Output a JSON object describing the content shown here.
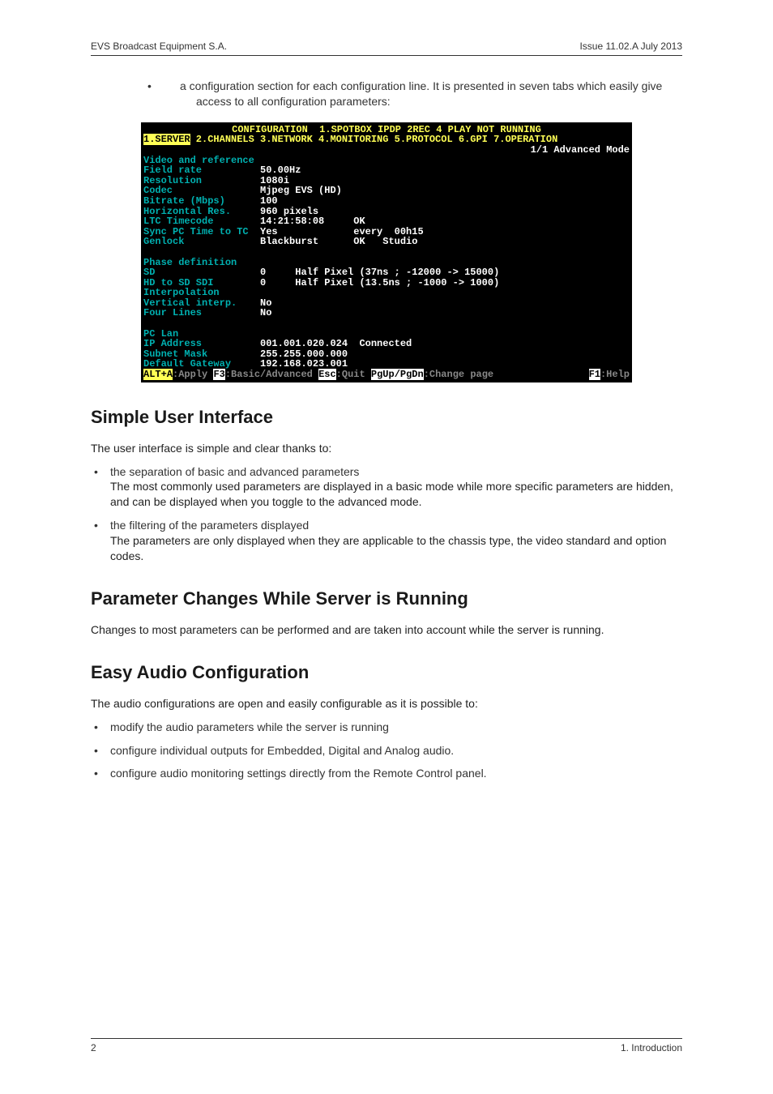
{
  "header": {
    "left": "EVS Broadcast Equipment S.A.",
    "right": "Issue 11.02.A  July 2013"
  },
  "intro": {
    "text": "a configuration section for each configuration line. It is presented in seven tabs which easily give access to all configuration parameters:"
  },
  "screenshot": {
    "title": "CONFIGURATION  1.SPOTBOX IPDP 2REC 4 PLAY NOT RUNNING",
    "tabs": {
      "selected": "1.SERVER",
      "rest": " 2.CHANNELS 3.NETWORK 4.MONITORING 5.PROTOCOL 6.GPI 7.OPERATION"
    },
    "mode": "1/1 Advanced Mode",
    "sections": [
      {
        "heading": "Video and reference",
        "rows": [
          {
            "label": "Field rate",
            "value": "50.00Hz"
          },
          {
            "label": "Resolution",
            "value": "1080i"
          },
          {
            "label": "Codec",
            "value": "Mjpeg EVS (HD)"
          },
          {
            "label": "Bitrate (Mbps)",
            "value": "100"
          },
          {
            "label": "Horizontal Res.",
            "value": "960 pixels"
          },
          {
            "label": "LTC Timecode",
            "value": "14:21:58:08     OK"
          },
          {
            "label": "Sync PC Time to TC",
            "value": "Yes             every  00h15"
          },
          {
            "label": "Genlock",
            "value": "Blackburst      OK   Studio"
          }
        ]
      },
      {
        "heading": "Phase definition",
        "rows": [
          {
            "label": "SD",
            "value": "0     Half Pixel (37ns ; -12000 -> 15000)"
          },
          {
            "label": "HD to SD SDI",
            "value": "0     Half Pixel (13.5ns ; -1000 -> 1000)"
          },
          {
            "label": "Interpolation",
            "value": ""
          },
          {
            "label": "Vertical interp.",
            "value": "No"
          },
          {
            "label": "Four Lines",
            "value": "No"
          }
        ]
      },
      {
        "heading": "PC Lan",
        "rows": [
          {
            "label": "IP Address",
            "value": "001.001.020.024  Connected"
          },
          {
            "label": "Subnet Mask",
            "value": "255.255.000.000"
          },
          {
            "label": "Default Gateway",
            "value": "192.168.023.001"
          }
        ]
      }
    ],
    "footer": {
      "k1": "ALT+A",
      "t1": ":Apply ",
      "k2": "F3",
      "t2": ":Basic/Advanced ",
      "k3": "Esc",
      "t3": ":Quit ",
      "k4": "PgUp/PgDn",
      "t4": ":Change page",
      "k5": "F1",
      "t5": ":Help"
    }
  },
  "sections": {
    "s1": {
      "title": "Simple User Interface",
      "intro": "The user interface is simple and clear thanks to:",
      "items": [
        {
          "text": "the separation of basic and advanced parameters",
          "sub": "The most commonly used parameters are displayed in a basic mode while more specific parameters are hidden, and can be displayed when you toggle to the advanced mode."
        },
        {
          "text": "the filtering of the parameters displayed",
          "sub": "The parameters are only displayed when they are applicable to the chassis type, the video standard and option codes."
        }
      ]
    },
    "s2": {
      "title": "Parameter Changes While Server is Running",
      "body": "Changes to most parameters can be performed and are taken into account while the server is running."
    },
    "s3": {
      "title": "Easy Audio Configuration",
      "intro": "The audio configurations are open and easily configurable as it is possible to:",
      "items": [
        {
          "text": "modify the audio parameters while the server is running"
        },
        {
          "text": "configure individual outputs for Embedded, Digital and Analog audio."
        },
        {
          "text": "configure audio monitoring settings directly from the Remote Control panel."
        }
      ]
    }
  },
  "footer": {
    "left": "2",
    "right": "1. Introduction"
  }
}
